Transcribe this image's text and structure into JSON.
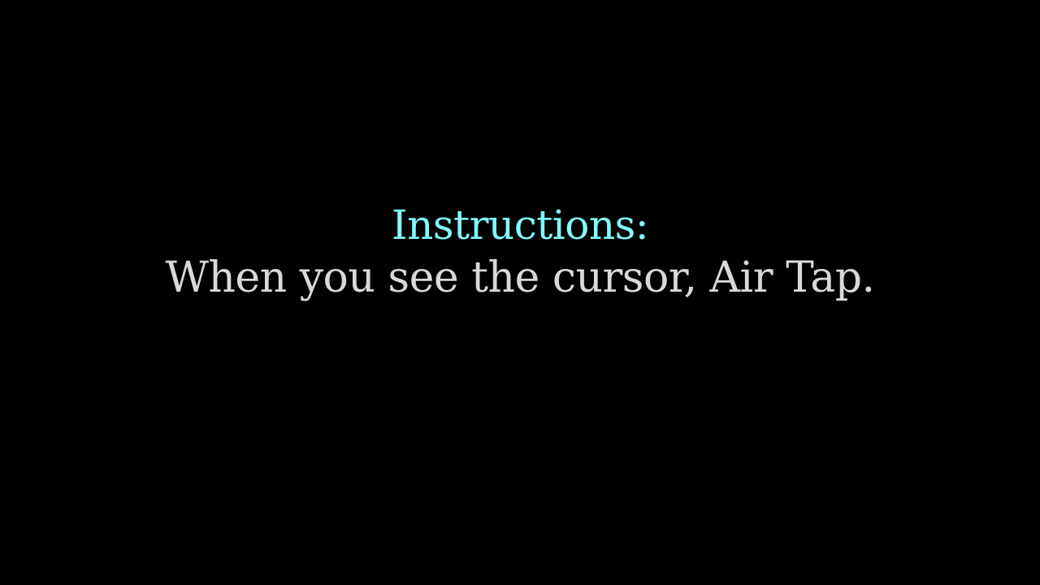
{
  "instructions": {
    "heading": "Instructions:",
    "message": "When you see the cursor, Air Tap."
  },
  "colors": {
    "background": "#000000",
    "heading": "#80FFFF",
    "message": "#D9D9D9"
  }
}
